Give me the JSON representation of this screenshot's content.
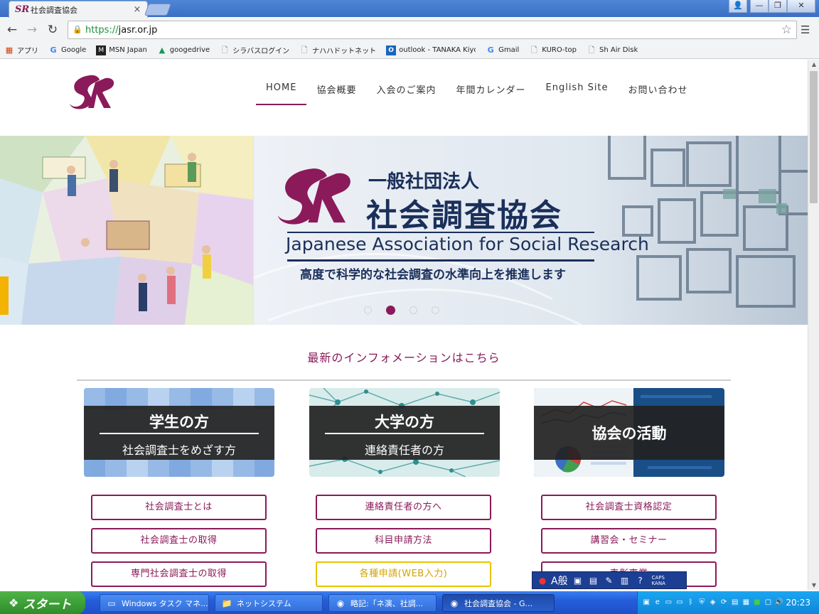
{
  "browser": {
    "tab": {
      "title": "社会調査協会",
      "close": "×"
    },
    "window_buttons": {
      "user": "👤",
      "minimize": "—",
      "maximize": "❐",
      "close": "✕"
    },
    "url": {
      "scheme": "https://",
      "host": "jasr.or.jp"
    },
    "bookmarks": [
      {
        "label": "アプリ",
        "icon": "apps-icon"
      },
      {
        "label": "Google",
        "icon": "google-icon"
      },
      {
        "label": "MSN Japan",
        "icon": "msn-icon"
      },
      {
        "label": "googedrive",
        "icon": "drive-icon"
      },
      {
        "label": "シラバスログイン",
        "icon": "page-icon"
      },
      {
        "label": "ナハハドットネット",
        "icon": "page-icon"
      },
      {
        "label": "outlook - TANAKA Kiyos",
        "icon": "outlook-icon"
      },
      {
        "label": "Gmail",
        "icon": "google-icon"
      },
      {
        "label": "KURO-top",
        "icon": "page-icon"
      },
      {
        "label": "Sh Air Disk",
        "icon": "page-icon"
      }
    ]
  },
  "site": {
    "nav": [
      "HOME",
      "協会概要",
      "入会のご案内",
      "年間カレンダー",
      "English Site",
      "お問い合わせ"
    ],
    "active_nav": "HOME",
    "brand_color": "#8b1a5a",
    "hero": {
      "org_type": "一般社団法人",
      "org_name": "社会調査協会",
      "org_name_en": "Japanese Association for Social Research",
      "tagline": "高度で科学的な社会調査の水準向上を推進します",
      "slide_count": 4,
      "active_slide": 2
    },
    "info_heading": "最新のインフォメーションはこちら",
    "cards": [
      {
        "title": "学生の方",
        "subtitle": "社会調査士をめざす方"
      },
      {
        "title": "大学の方",
        "subtitle": "連絡責任者の方"
      },
      {
        "title": "協会の活動",
        "subtitle": ""
      }
    ],
    "links": {
      "col1": [
        "社会調査士とは",
        "社会調査士の取得",
        "専門社会調査士の取得"
      ],
      "col2": [
        "連絡責任者の方へ",
        "科目申請方法",
        "各種申請(WEB入力)"
      ],
      "col3": [
        "社会調査士資格認定",
        "講習会・セミナー",
        "表彰事業"
      ]
    }
  },
  "ime": {
    "mode": "A般",
    "caps": "CAPS",
    "kana": "KANA"
  },
  "taskbar": {
    "start": "スタート",
    "tasks": [
      {
        "label": "Windows タスク マネ...",
        "icon": "task-manager-icon"
      },
      {
        "label": "ネットシステム",
        "icon": "folder-icon"
      },
      {
        "label": "略記:「ネ演、社調...",
        "icon": "chrome-icon"
      },
      {
        "label": "社会調査協会 - G...",
        "icon": "chrome-icon"
      }
    ],
    "clock": "20:23"
  }
}
